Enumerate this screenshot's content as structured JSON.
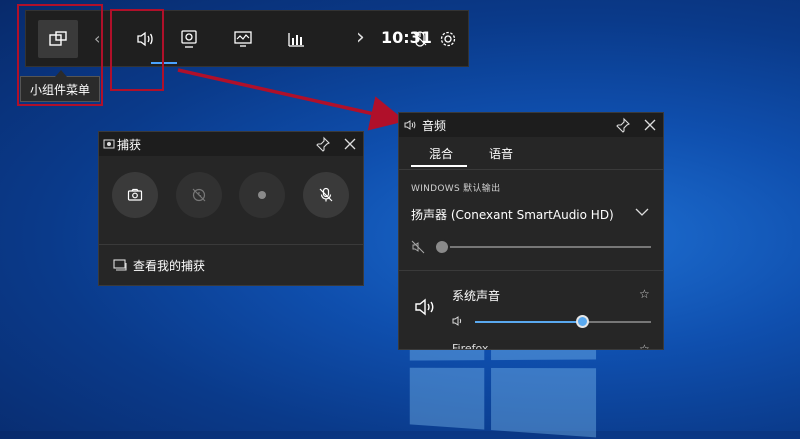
{
  "gamebar": {
    "time": "10:31",
    "tooltip": "小组件菜单",
    "icons": [
      "widget-menu-icon",
      "audio-icon",
      "capture-icon",
      "performance-icon",
      "resources-icon",
      "chevron-right-icon",
      "mouse-icon",
      "gear-icon"
    ]
  },
  "capture": {
    "title": "捕获",
    "footer": "查看我的捕获"
  },
  "audio": {
    "title": "音频",
    "tabs": [
      {
        "label": "混合"
      },
      {
        "label": "语音"
      }
    ],
    "section": "WINDOWS 默认输出",
    "device": "扬声器 (Conexant SmartAudio HD)",
    "master_volume": 0,
    "system": {
      "label": "系统声音",
      "volume": 0.61
    },
    "next_app": "Firefox"
  },
  "colors": {
    "accent": "#5aa9ef",
    "annotation": "#b0102a",
    "panel": "#262626"
  }
}
